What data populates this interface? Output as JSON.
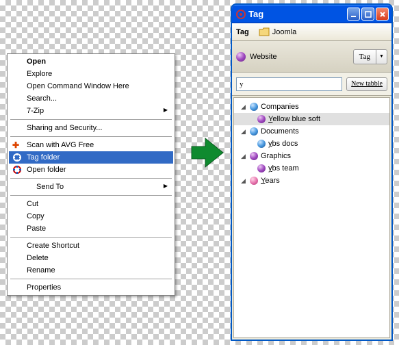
{
  "contextMenu": {
    "open": "Open",
    "explore": "Explore",
    "openCmd": "Open Command Window Here",
    "search": "Search...",
    "sevenZip": "7-Zip",
    "sharing": "Sharing and Security...",
    "scanAvg": "Scan with AVG Free",
    "tagFolder": "Tag folder",
    "openFolder": "Open folder",
    "sendTo": "Send To",
    "cut": "Cut",
    "copy": "Copy",
    "paste": "Paste",
    "createShortcut": "Create Shortcut",
    "delete": "Delete",
    "rename": "Rename",
    "properties": "Properties"
  },
  "tagWindow": {
    "title": "Tag",
    "breadcrumbLabel": "Tag",
    "breadcrumbPath": "Joomla",
    "locationLabel": "Website",
    "tagButton": "Tag",
    "searchValue": "y",
    "newTableButton": "New tabble",
    "tree": {
      "companies": {
        "label": "Companies",
        "child": {
          "pre": "Y",
          "rest": "ellow blue soft"
        }
      },
      "documents": {
        "label": "Documents",
        "child": {
          "pre": "y",
          "rest": "bs docs"
        }
      },
      "graphics": {
        "label": "Graphics",
        "child": {
          "pre": "y",
          "rest": "bs team"
        }
      },
      "years": {
        "pre": "Y",
        "rest": "ears"
      }
    }
  }
}
